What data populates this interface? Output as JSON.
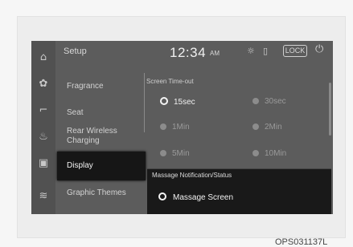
{
  "header": {
    "title": "Setup",
    "time": "12:34",
    "ampm": "AM",
    "lock_label": "LOCK",
    "icons": [
      "brightness-icon",
      "phone-projection-icon",
      "power-icon"
    ]
  },
  "rail": {
    "icons": [
      "home-icon",
      "fan-icon",
      "seat-icon",
      "seat-heat-icon",
      "display-icon",
      "climate-icon"
    ]
  },
  "menu": {
    "items": [
      "Fragrance",
      "Seat",
      "Rear Wireless Charging",
      "Display",
      "Graphic Themes"
    ],
    "selected": "Display"
  },
  "screen_timeout": {
    "label": "Screen Time-out",
    "options": [
      "15sec",
      "30sec",
      "1Min",
      "2Min",
      "5Min",
      "10Min"
    ],
    "selected": "15sec"
  },
  "massage_popup": {
    "title": "Massage Notification/Status",
    "option": "Massage Screen",
    "selected": true
  },
  "caption": "OPS031137L"
}
